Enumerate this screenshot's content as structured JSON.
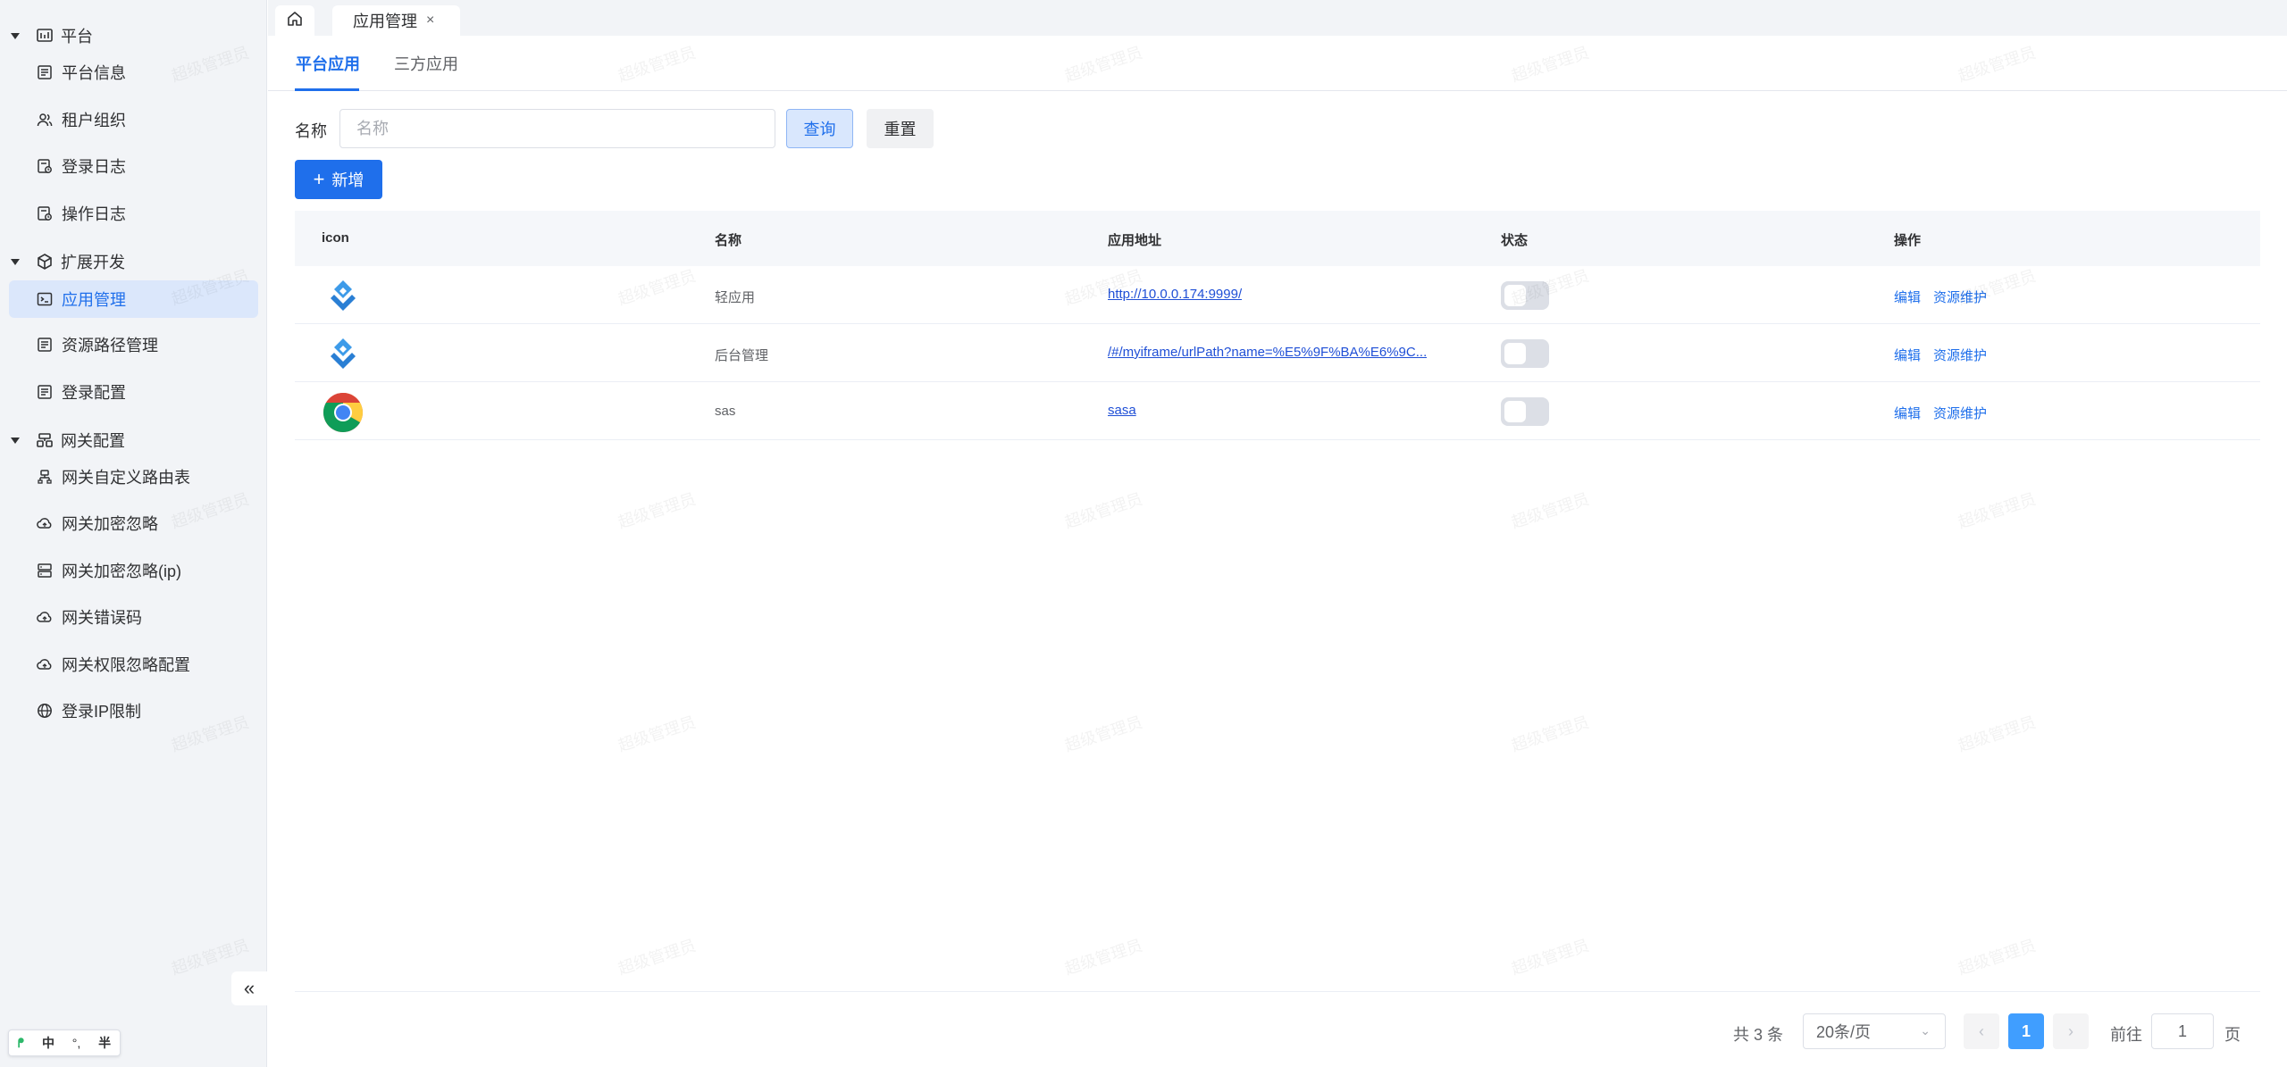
{
  "sidebar": {
    "groups": [
      {
        "label": "平台",
        "icon": "dashboard-icon",
        "items": [
          {
            "label": "平台信息",
            "icon": "doc-list-icon"
          },
          {
            "label": "租户组织",
            "icon": "users-icon"
          },
          {
            "label": "登录日志",
            "icon": "log-icon"
          },
          {
            "label": "操作日志",
            "icon": "log-icon"
          }
        ]
      },
      {
        "label": "扩展开发",
        "icon": "cube-icon",
        "items": [
          {
            "label": "应用管理",
            "icon": "terminal-icon",
            "active": true
          },
          {
            "label": "资源路径管理",
            "icon": "doc-list-icon"
          },
          {
            "label": "登录配置",
            "icon": "doc-list-icon"
          }
        ]
      },
      {
        "label": "网关配置",
        "icon": "gateway-icon",
        "items": [
          {
            "label": "网关自定义路由表",
            "icon": "route-icon"
          },
          {
            "label": "网关加密忽略",
            "icon": "cloud-icon"
          },
          {
            "label": "网关加密忽略(ip)",
            "icon": "server-icon"
          },
          {
            "label": "网关错误码",
            "icon": "cloud-icon"
          },
          {
            "label": "网关权限忽略配置",
            "icon": "cloud-icon"
          },
          {
            "label": "登录IP限制",
            "icon": "globe-icon"
          }
        ]
      }
    ],
    "collapse_label": "«"
  },
  "ime": {
    "logo": "ᖰ",
    "lang": "中",
    "punct": "°,",
    "width": "半"
  },
  "tabs": {
    "home_icon": "home-icon",
    "current": "应用管理",
    "close": "×"
  },
  "subtabs": {
    "platform": "平台应用",
    "third": "三方应用"
  },
  "search": {
    "label": "名称",
    "placeholder": "名称",
    "value": "",
    "query": "查询",
    "reset": "重置",
    "add": "新增",
    "add_plus": "+"
  },
  "table": {
    "headers": {
      "icon": "icon",
      "name": "名称",
      "url": "应用地址",
      "status": "状态",
      "action": "操作"
    },
    "rows": [
      {
        "icon": "app-diamond-icon",
        "name": "轻应用",
        "url": "http://10.0.0.174:9999/",
        "enabled": false,
        "edit": "编辑",
        "resource": "资源维护"
      },
      {
        "icon": "app-diamond-icon",
        "name": "后台管理",
        "url": "/#/myiframe/urlPath?name=%E5%9F%BA%E6%9C...",
        "enabled": false,
        "edit": "编辑",
        "resource": "资源维护"
      },
      {
        "icon": "chrome-icon",
        "name": "sas",
        "url": "sasa",
        "enabled": false,
        "edit": "编辑",
        "resource": "资源维护"
      }
    ]
  },
  "pagination": {
    "total": "共 3 条",
    "page_size": "20条/页",
    "current": "1",
    "goto": "前往",
    "goto_value": "1",
    "page_suffix": "页",
    "prev": "‹",
    "next": "›"
  },
  "watermark": "超级管理员",
  "colors": {
    "primary": "#1f6feb",
    "active_bg": "#dbe7fb",
    "sidebar_bg": "#f2f4f7",
    "pager_active": "#409eff"
  }
}
